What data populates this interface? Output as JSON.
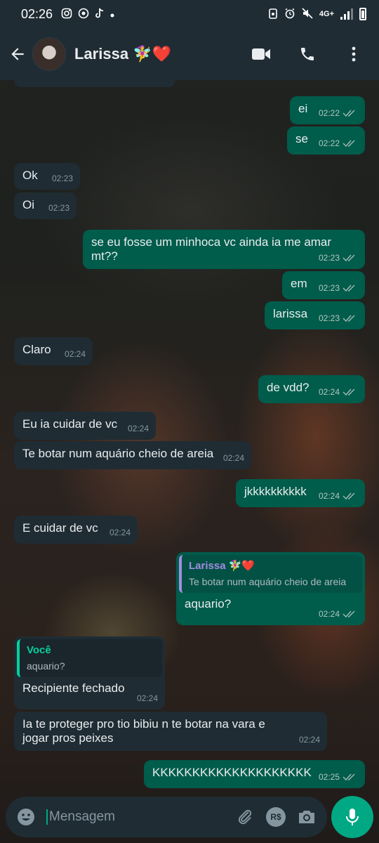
{
  "status_bar": {
    "time": "02:26",
    "network": "4G+"
  },
  "header": {
    "contact_name": "Larissa 🧚‍♀️❤️",
    "icons": [
      "back-arrow-icon",
      "video-call-icon",
      "voice-call-icon",
      "more-options-icon"
    ]
  },
  "colors": {
    "incoming_bubble": "#1f2c34",
    "outgoing_bubble": "#005c4b",
    "accent": "#00a884",
    "read_ticks": "#53bdeb"
  },
  "messages": [
    {
      "dir": "out",
      "text": "ei",
      "time": "02:22"
    },
    {
      "dir": "out",
      "text": "se",
      "time": "02:22"
    },
    {
      "dir": "in",
      "text": "Ok",
      "time": "02:23"
    },
    {
      "dir": "in",
      "text": "Oi",
      "time": "02:23"
    },
    {
      "dir": "out",
      "text": "se eu fosse um minhoca vc ainda ia me amar mt??",
      "time": "02:23"
    },
    {
      "dir": "out",
      "text": "em",
      "time": "02:23"
    },
    {
      "dir": "out",
      "text": "larissa",
      "time": "02:23"
    },
    {
      "dir": "in",
      "text": "Claro",
      "time": "02:24"
    },
    {
      "dir": "out",
      "text": "de vdd?",
      "time": "02:24"
    },
    {
      "dir": "in",
      "text": "Eu ia cuidar de vc",
      "time": "02:24"
    },
    {
      "dir": "in",
      "text": "Te botar num aquário cheio de areia",
      "time": "02:24"
    },
    {
      "dir": "out",
      "text": "jkkkkkkkkkk",
      "time": "02:24"
    },
    {
      "dir": "in",
      "text": "E cuidar de vc",
      "time": "02:24"
    },
    {
      "dir": "out",
      "text": "aquario?",
      "time": "02:24",
      "quote_name": "Larissa 🧚‍♀️❤️",
      "quote_text": "Te botar num aquário cheio de areia"
    },
    {
      "dir": "in",
      "text": "Recipiente fechado",
      "time": "02:24",
      "quote_name": "Você",
      "quote_text": "aquario?"
    },
    {
      "dir": "in",
      "text": "Ia te proteger pro tio bibiu n te botar na vara e jogar pros peixes",
      "time": "02:24"
    },
    {
      "dir": "out",
      "text": "KKKKKKKKKKKKKKKKKKKK",
      "time": "02:25"
    }
  ],
  "input": {
    "placeholder": "Mensagem",
    "currency_label": "R$",
    "icons": [
      "emoji-icon",
      "attach-icon",
      "payment-icon",
      "camera-icon",
      "microphone-icon"
    ]
  }
}
